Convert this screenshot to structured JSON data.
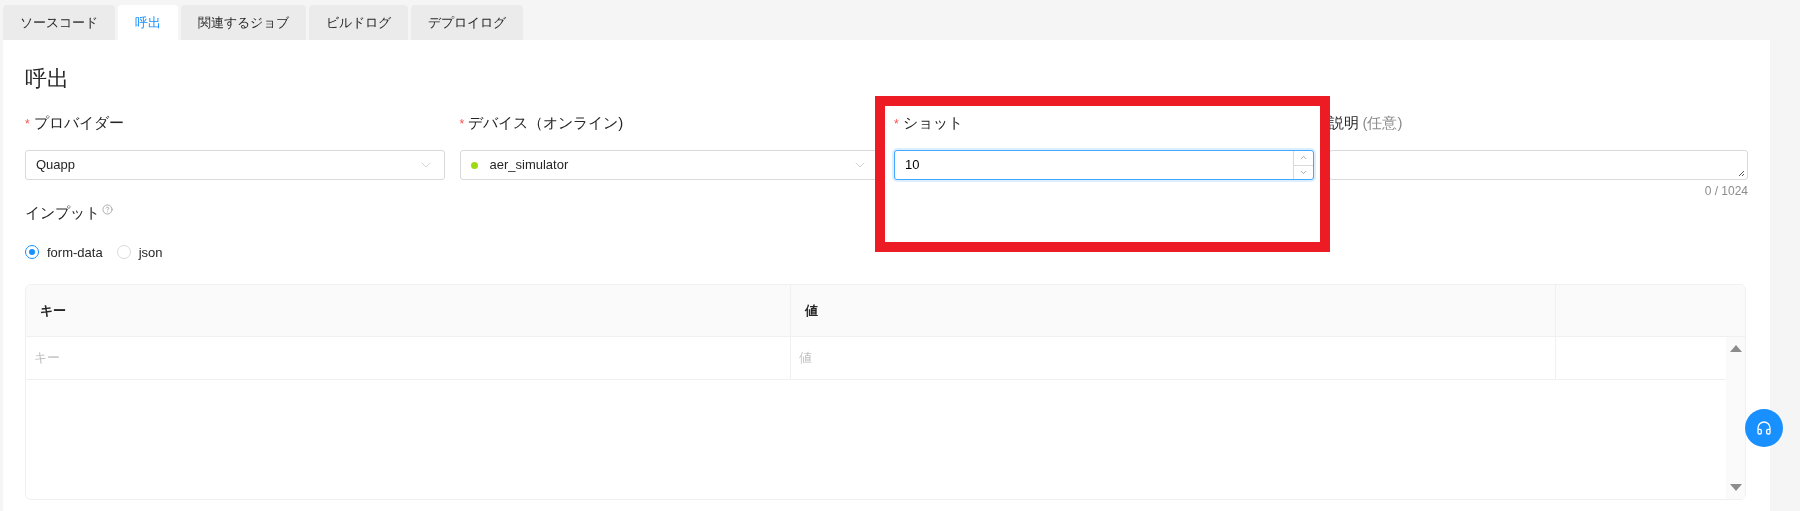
{
  "tabs": [
    {
      "label": "ソースコード",
      "selected": false
    },
    {
      "label": "呼出",
      "selected": true
    },
    {
      "label": "関連するジョブ",
      "selected": false
    },
    {
      "label": "ビルドログ",
      "selected": false
    },
    {
      "label": "デプロイログ",
      "selected": false
    }
  ],
  "title": "呼出",
  "fields": [
    {
      "kind": "select",
      "required_mark": "*",
      "label": "プロバイダー",
      "value": "Quapp"
    },
    {
      "kind": "select",
      "required_mark": "*",
      "label": "デバイス（オンライン)",
      "value": "aer_simulator",
      "color": "#a0d911"
    },
    {
      "kind": "number",
      "required_mark": "*",
      "label": "ショット",
      "value": "10",
      "focused": true
    },
    {
      "kind": "textarea",
      "label": "説明",
      "note": "(任意)",
      "counter": "0 / 1024"
    }
  ],
  "input_section": {
    "label": "インプット",
    "options": [
      {
        "label": "form-data",
        "selected": true
      },
      {
        "label": "json",
        "selected": false
      }
    ]
  },
  "table": {
    "columns": [
      "キー",
      "値"
    ],
    "rows": [
      {
        "key_placeholder": "キー",
        "value_placeholder": "値"
      }
    ]
  }
}
